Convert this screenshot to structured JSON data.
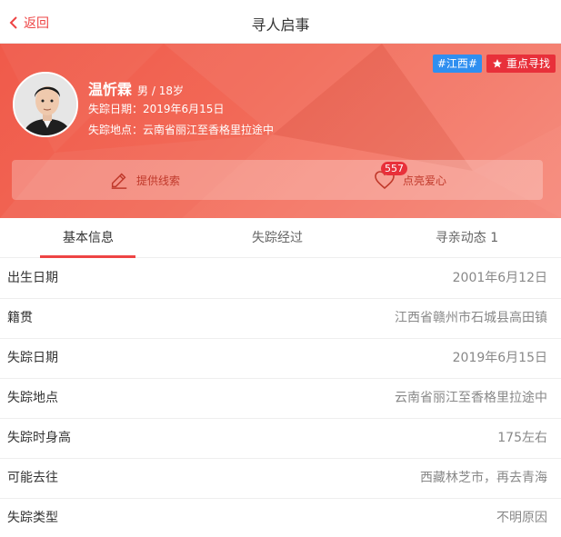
{
  "header": {
    "back_label": "返回",
    "title": "寻人启事"
  },
  "tags": {
    "region": "#江西#",
    "priority": "重点寻找"
  },
  "person": {
    "name": "温忻霖",
    "gender_age": "男 / 18岁",
    "missing_date_line": "失踪日期：2019年6月15日",
    "missing_place_line": "失踪地点：云南省丽江至香格里拉途中"
  },
  "actions": {
    "clue_label": "提供线索",
    "love_label": "点亮爱心",
    "love_count": "557"
  },
  "tabs": [
    {
      "label": "基本信息"
    },
    {
      "label": "失踪经过"
    },
    {
      "label": "寻亲动态 1"
    }
  ],
  "details": [
    {
      "label": "出生日期",
      "value": "2001年6月12日"
    },
    {
      "label": "籍贯",
      "value": "江西省赣州市石城县高田镇"
    },
    {
      "label": "失踪日期",
      "value": "2019年6月15日"
    },
    {
      "label": "失踪地点",
      "value": "云南省丽江至香格里拉途中"
    },
    {
      "label": "失踪时身高",
      "value": "175左右"
    },
    {
      "label": "可能去往",
      "value": "西藏林芝市，再去青海"
    },
    {
      "label": "失踪类型",
      "value": "不明原因"
    }
  ],
  "colors": {
    "accent": "#ee4444",
    "hero": "#f26a58",
    "tag_blue": "#2f8ff0",
    "tag_red": "#e8303a"
  }
}
